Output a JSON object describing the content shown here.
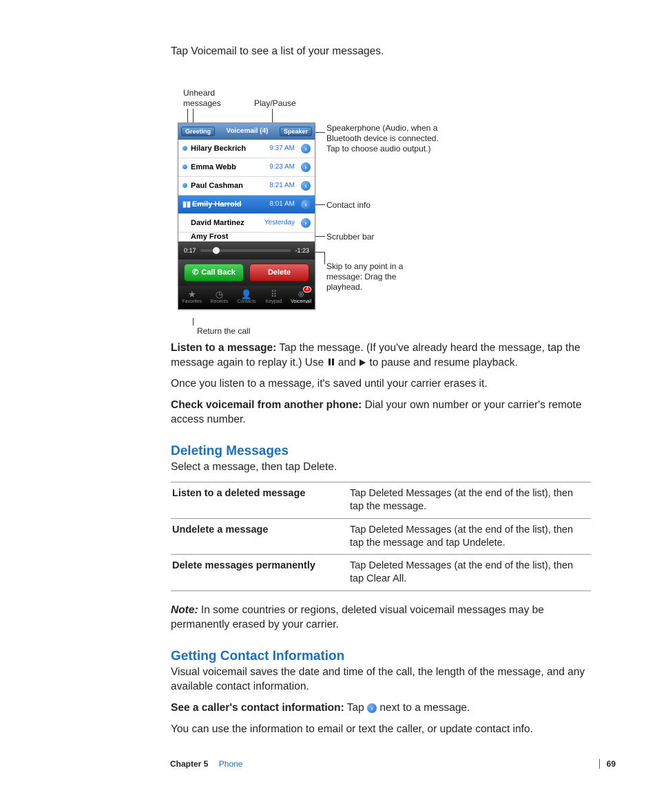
{
  "intro": "Tap Voicemail to see a list of your messages.",
  "callouts": {
    "unheard": "Unheard messages",
    "playpause": "Play/Pause",
    "speaker": "Speakerphone (Audio, when a Bluetooth device is connected. Tap to choose audio output.)",
    "contact": "Contact info",
    "scrubber": "Scrubber bar",
    "skip": "Skip to any point in a message: Drag the playhead.",
    "return": "Return the call"
  },
  "phone": {
    "nav": {
      "left": "Greeting",
      "title": "Voicemail (4)",
      "right": "Speaker"
    },
    "rows": [
      {
        "dot": true,
        "name": "Hilary Beckrich",
        "time": "9:37 AM",
        "sel": false
      },
      {
        "dot": true,
        "name": "Emma Webb",
        "time": "9:23 AM",
        "sel": false
      },
      {
        "dot": true,
        "name": "Paul Cashman",
        "time": "8:21 AM",
        "sel": false
      },
      {
        "dot": false,
        "name": "Emily Harrold",
        "time": "8:01 AM",
        "sel": true
      },
      {
        "dot": false,
        "name": "David Martinez",
        "time": "Yesterday",
        "sel": false
      },
      {
        "dot": false,
        "name": "Amy Frost",
        "time": "",
        "sel": false,
        "cut": true
      }
    ],
    "scrubber": {
      "left": "0:17",
      "right": "-1:23"
    },
    "actions": {
      "callback": "Call Back",
      "delete": "Delete"
    },
    "tabs": [
      {
        "icon": "★",
        "label": "Favorites"
      },
      {
        "icon": "◷",
        "label": "Recents"
      },
      {
        "icon": "👤",
        "label": "Contacts"
      },
      {
        "icon": "⠿",
        "label": "Keypad"
      },
      {
        "icon": "⌾",
        "label": "Voicemail",
        "badge": "4",
        "active": true
      }
    ]
  },
  "listen_head": "Listen to a message:",
  "listen_body_a": " Tap the message. (If you've already heard the message, tap the message again to replay it.) Use ",
  "listen_body_b": " and ",
  "listen_body_c": " to pause and resume playback.",
  "saved": "Once you listen to a message, it's saved until your carrier erases it.",
  "check_head": "Check voicemail from another phone:",
  "check_body": " Dial your own number or your carrier's remote access number.",
  "del_heading": "Deleting Messages",
  "del_intro": "Select a message, then tap Delete.",
  "table": [
    {
      "a": "Listen to a deleted message",
      "b": "Tap Deleted Messages (at the end of the list), then tap the message."
    },
    {
      "a": "Undelete a message",
      "b": "Tap Deleted Messages (at the end of the list), then tap the message and tap Undelete."
    },
    {
      "a": "Delete messages permanently",
      "b": "Tap Deleted Messages (at the end of the list), then tap Clear All."
    }
  ],
  "note_head": "Note:",
  "note_body": "  In some countries or regions, deleted visual voicemail messages may be permanently erased by your carrier.",
  "gci_heading": "Getting Contact Information",
  "gci_intro": "Visual voicemail saves the date and time of the call, the length of the message, and any available contact information.",
  "see_head": "See a caller's contact information:",
  "see_a": "  Tap ",
  "see_b": " next to a message.",
  "use_info": "You can use the information to email or text the caller, or update contact info.",
  "footer": {
    "chapter": "Chapter 5",
    "name": "Phone",
    "page": "69"
  }
}
